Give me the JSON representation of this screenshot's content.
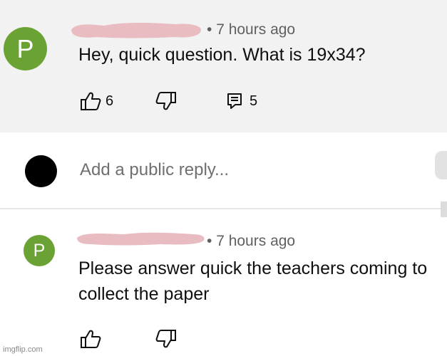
{
  "comment": {
    "avatar_letter": "P",
    "time": "7 hours ago",
    "text": "Hey, quick question. What is 19x34?",
    "likes": "6",
    "replies": "5"
  },
  "reply_box": {
    "placeholder": "Add a public reply..."
  },
  "reply": {
    "avatar_letter": "P",
    "time": "7 hours ago",
    "text_line1": "Please answer quick the teachers coming to",
    "text_line2": "collect the paper"
  },
  "watermark": "imgflip.com",
  "colors": {
    "avatar_green": "#6aa233",
    "redaction_pink": "#e8bcc1",
    "panel_gray": "#f2f2f2"
  }
}
